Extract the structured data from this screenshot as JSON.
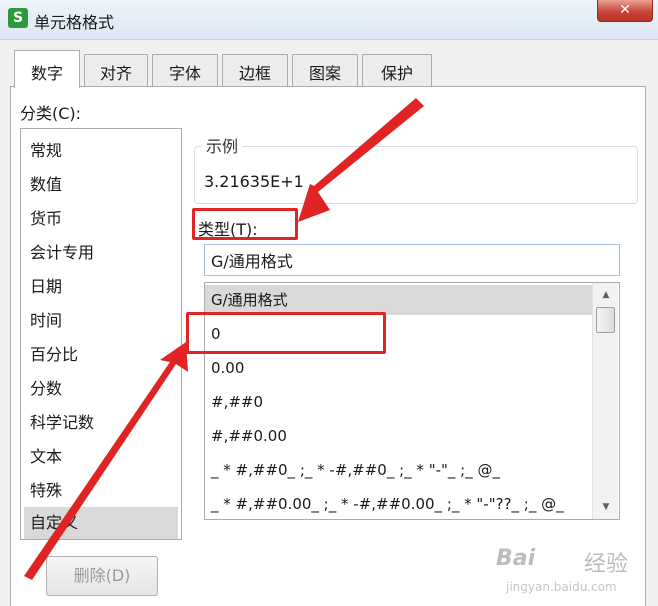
{
  "window": {
    "title": "单元格格式",
    "app_icon_glyph": "S",
    "close_glyph": "✕"
  },
  "tabs": [
    {
      "label": "数字",
      "active": true
    },
    {
      "label": "对齐",
      "active": false
    },
    {
      "label": "字体",
      "active": false
    },
    {
      "label": "边框",
      "active": false
    },
    {
      "label": "图案",
      "active": false
    },
    {
      "label": "保护",
      "active": false
    }
  ],
  "category": {
    "label": "分类(C):",
    "items": [
      "常规",
      "数值",
      "货币",
      "会计专用",
      "日期",
      "时间",
      "百分比",
      "分数",
      "科学记数",
      "文本",
      "特殊",
      "自定义"
    ],
    "selected": "自定义"
  },
  "sample": {
    "label": "示例",
    "value": "3.21635E+1"
  },
  "type": {
    "label": "类型(T):",
    "input_value": "G/通用格式",
    "items": [
      "G/通用格式",
      "0",
      "0.00",
      "#,##0",
      "#,##0.00",
      "_ * #,##0_ ;_ * -#,##0_ ;_ * \"-\"_ ;_ @_",
      "_ * #,##0.00_ ;_ * -#,##0.00_ ;_ * \"-\"??_ ;_ @_"
    ],
    "selected": "G/通用格式",
    "scroll_up_icon": "▲",
    "scroll_down_icon": "▼"
  },
  "buttons": {
    "delete_label": "删除(D)"
  },
  "annotation_color": "#e02424",
  "watermark": {
    "logo": "Bai",
    "text": "经验",
    "url": "jingyan.baidu.com"
  }
}
